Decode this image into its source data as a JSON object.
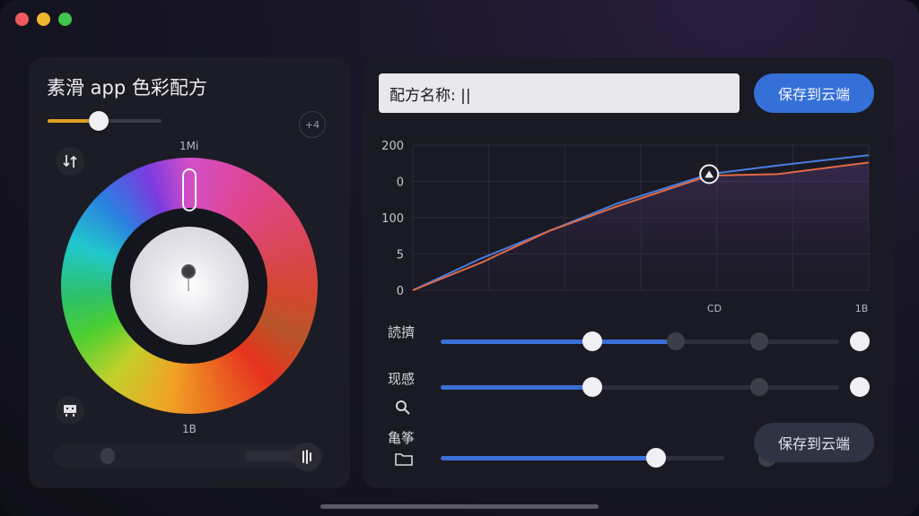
{
  "window": {
    "traffic_lights": [
      "close",
      "minimize",
      "zoom"
    ],
    "colors": {
      "close": "#ed5a5b",
      "minimize": "#f2b731",
      "zoom": "#3fc44d"
    }
  },
  "left_panel": {
    "title": "素滑 app 色彩配方",
    "top_slider_value": 0.45,
    "top_slider_color": "#e0a020",
    "plus_label": "+4",
    "wheel_top_label": "1Mi",
    "wheel_bottom_label": "1B",
    "icons": [
      "swap-vertical-icon",
      "grid-icon",
      "add-icon"
    ]
  },
  "right_panel": {
    "name_input_value": "配方名称: ||",
    "save_button_top": "保存到云端",
    "save_button_bottom": "保存到云端",
    "accent_color": "#3470d8"
  },
  "chart_data": {
    "type": "line",
    "y_tick_labels": [
      "200",
      "0",
      "100",
      "5",
      "0"
    ],
    "x_tick_labels": [
      "CD",
      "1B"
    ],
    "grid": true,
    "series": [
      {
        "color": "#4a7de0",
        "points": [
          [
            0,
            0
          ],
          [
            0.15,
            0.22
          ],
          [
            0.3,
            0.41
          ],
          [
            0.45,
            0.6
          ],
          [
            0.65,
            0.8
          ],
          [
            0.8,
            0.86
          ],
          [
            1.0,
            0.93
          ]
        ]
      },
      {
        "color": "#e06a48",
        "points": [
          [
            0,
            0
          ],
          [
            0.15,
            0.19
          ],
          [
            0.3,
            0.41
          ],
          [
            0.45,
            0.58
          ],
          [
            0.65,
            0.79
          ],
          [
            0.8,
            0.8
          ],
          [
            1.0,
            0.88
          ]
        ]
      }
    ],
    "marker_x": 0.65
  },
  "sliders": [
    {
      "label": "読擠",
      "value": 0.38,
      "fill_to": 0.58,
      "dots": [
        0.59,
        0.8
      ],
      "end_dot": true
    },
    {
      "label": "现感",
      "value": 0.38,
      "dots": [
        0.8
      ],
      "end_dot": true
    },
    {
      "label": "亀筝",
      "value": 0.54,
      "dots": [
        0.82
      ],
      "end_dot": false
    }
  ],
  "side_icons": [
    "search-icon",
    "folder-icon"
  ]
}
